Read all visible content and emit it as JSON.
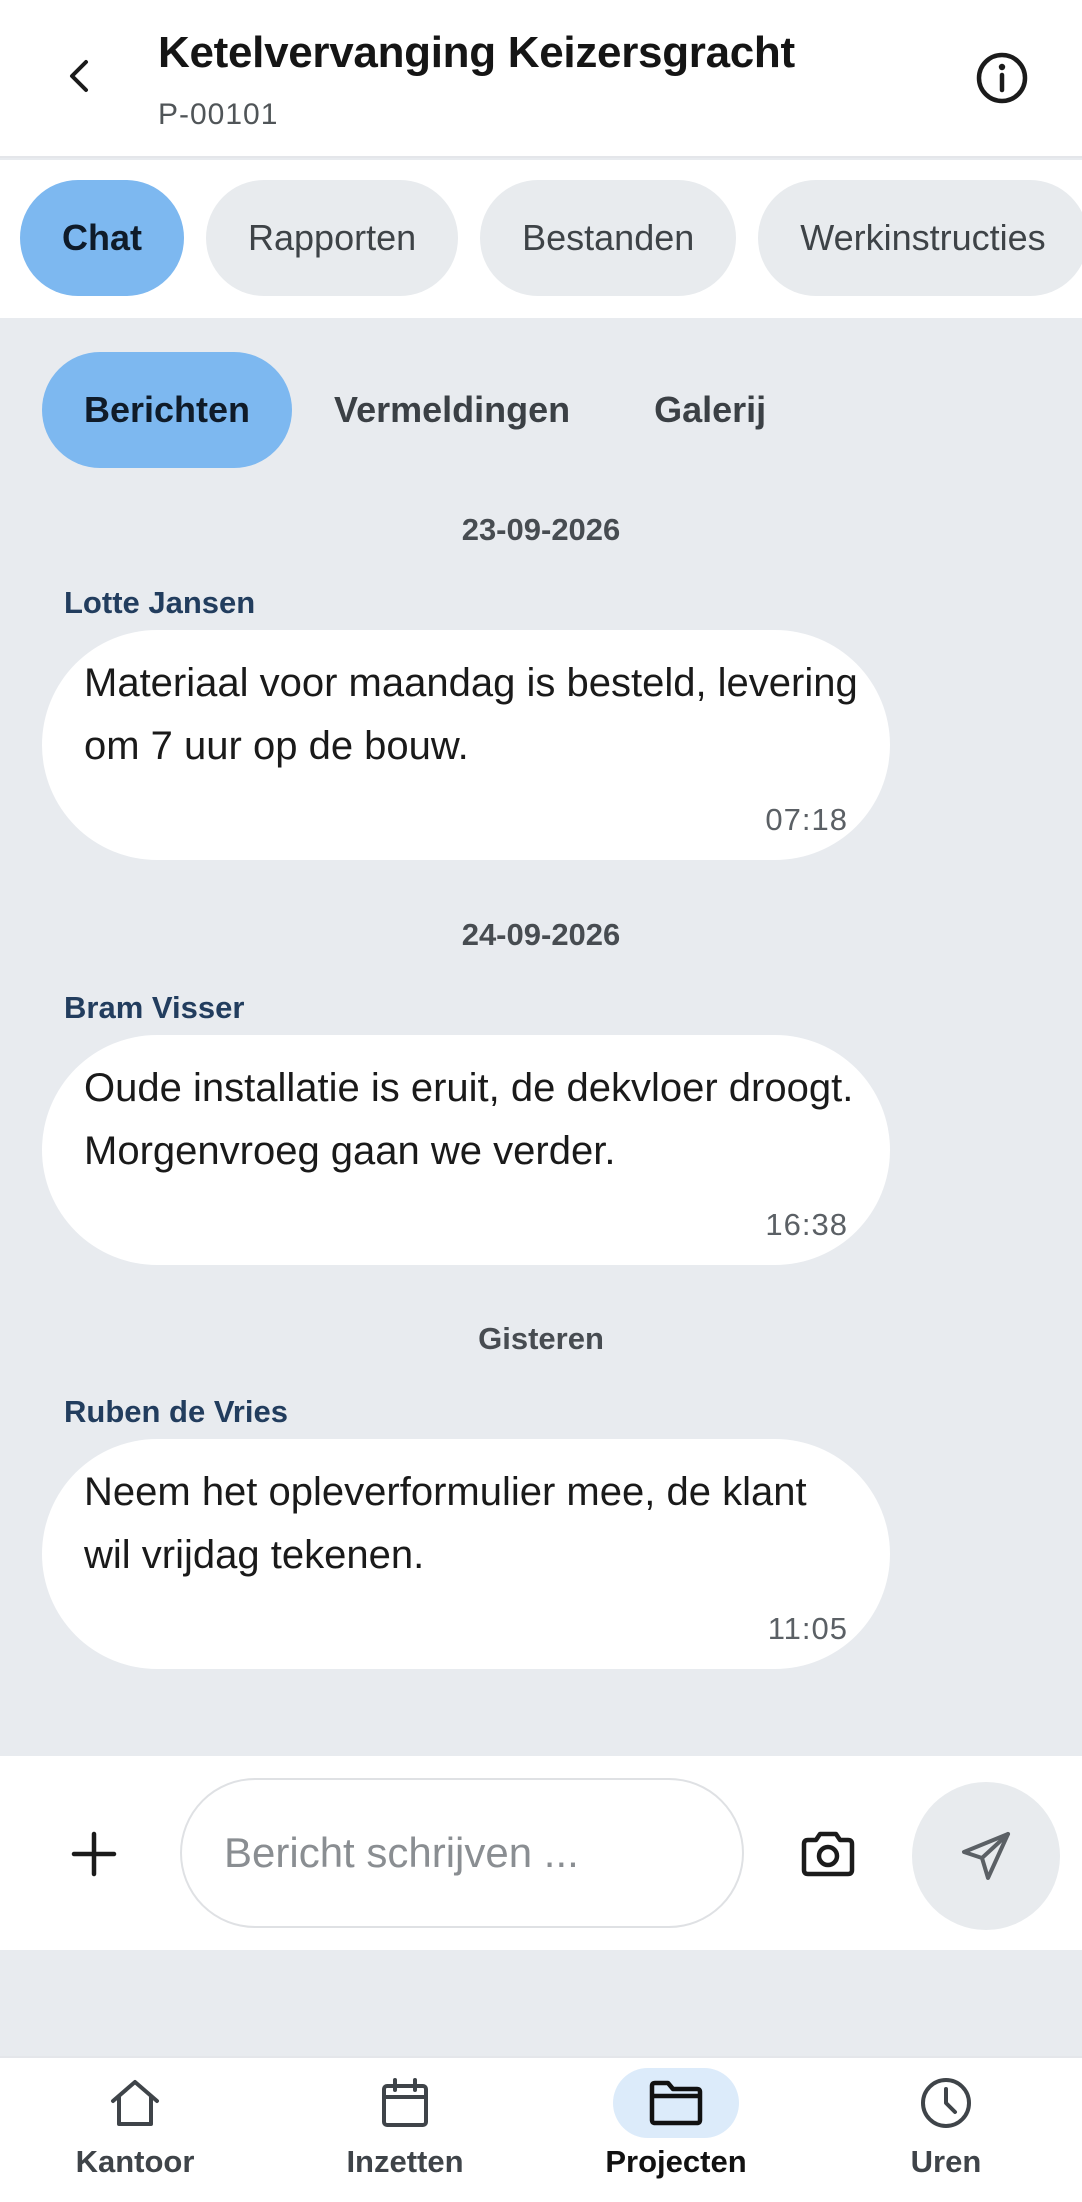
{
  "header": {
    "title": "Ketelvervanging Keizersgracht",
    "project_code": "P-00101",
    "back_icon": "chevron-left-icon",
    "info_icon": "info-icon"
  },
  "top_tabs": [
    {
      "label": "Chat",
      "active": true
    },
    {
      "label": "Rapporten",
      "active": false
    },
    {
      "label": "Bestanden",
      "active": false
    },
    {
      "label": "Werkinstructies",
      "active": false
    }
  ],
  "sub_tabs": [
    {
      "label": "Berichten",
      "active": true
    },
    {
      "label": "Vermeldingen",
      "active": false
    },
    {
      "label": "Galerij",
      "active": false
    }
  ],
  "messages": [
    {
      "date": "23-09-2026",
      "sender": "Lotte Jansen",
      "text": "Materiaal voor maandag is besteld, levering om 7 uur op de bouw.",
      "time": "07:18"
    },
    {
      "date": "24-09-2026",
      "sender": "Bram Visser",
      "text": "Oude installatie is eruit, de dekvloer droogt. Morgenvroeg gaan we verder.",
      "time": "16:38"
    },
    {
      "date": "Gisteren",
      "sender": "Ruben de Vries",
      "text": "Neem het opleverformulier mee, de klant wil vrijdag tekenen.",
      "time": "11:05"
    }
  ],
  "composer": {
    "placeholder": "Bericht schrijven ...",
    "value": ""
  },
  "bottom_nav": [
    {
      "label": "Kantoor",
      "icon": "home-icon",
      "active": false
    },
    {
      "label": "Inzetten",
      "icon": "calendar-icon",
      "active": false
    },
    {
      "label": "Projecten",
      "icon": "folder-icon",
      "active": true
    },
    {
      "label": "Uren",
      "icon": "clock-icon",
      "active": false
    }
  ],
  "colors": {
    "accent": "#7db8f0",
    "accent_light": "#dcebfa",
    "background": "#e8ebef",
    "sender_name": "#223d5e"
  }
}
